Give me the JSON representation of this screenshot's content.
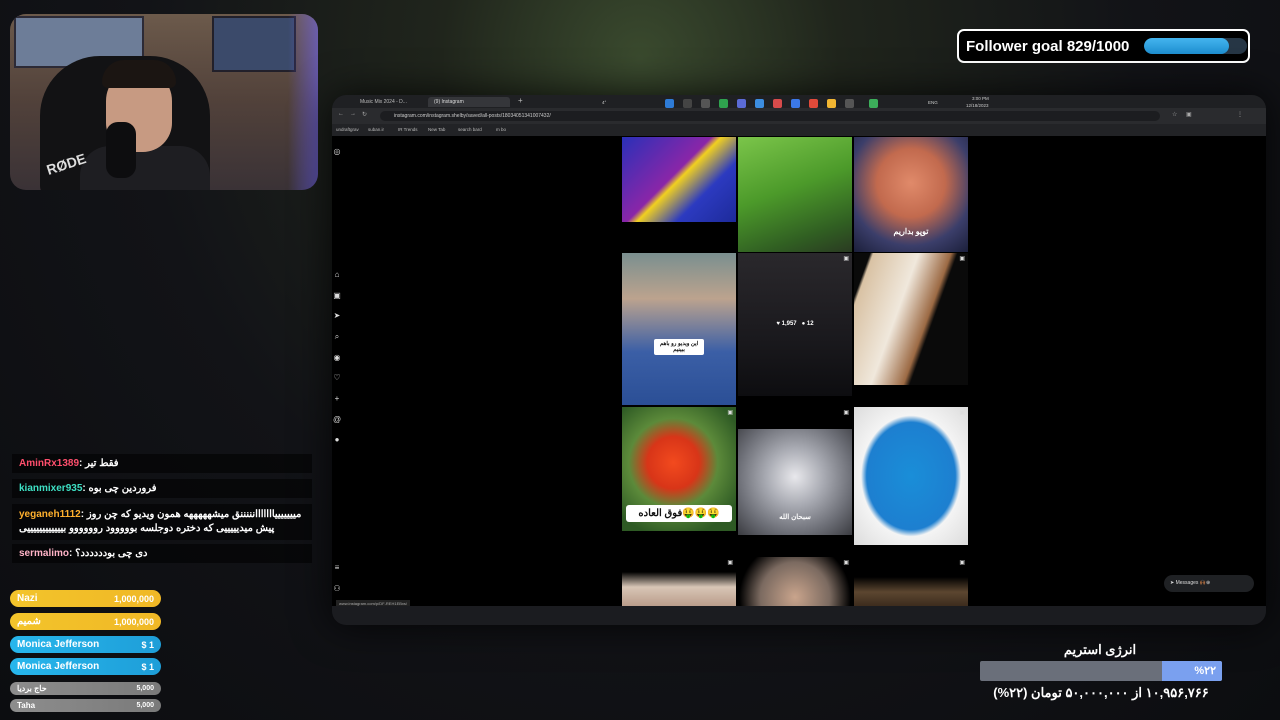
{
  "follower_goal": {
    "text": "Follower goal 829/1000",
    "current": 829,
    "target": 1000
  },
  "browser": {
    "tabs": [
      "Music Mix 2024 - D...",
      "(9) Instagram"
    ],
    "url": "instagram.com/instagram.shelby/saved/all-posts/18034051341007432/",
    "bookmarks": [
      "undraftgrav",
      "suban.ir",
      "IR Trends",
      "New Tab",
      "search bard",
      "m bo"
    ],
    "messages_label": "Messages",
    "status_url": "www.instagram.com/p/DF-REH1EBxs/"
  },
  "feed": {
    "captions": {
      "c3": "توپو بداریم",
      "c4": "این ویدیو رو باهم ببینیم",
      "c7": "فوق العاده🤑🤑🤑",
      "c8": "سبحان الله"
    },
    "post5_stats": {
      "likes": "1,957",
      "comments": "12"
    }
  },
  "taskbar": {
    "weather": "4°",
    "lang": "ENG",
    "time": "3:00 PM",
    "date": "12/18/2023"
  },
  "chat": [
    {
      "user": "AminRx1389",
      "message": "فقط تیر",
      "color": "#ff4f6d"
    },
    {
      "user": "kianmixer935",
      "message": "فروردین چی بوه",
      "color": "#3ee0c4"
    },
    {
      "user": "yeganeh1112",
      "message": "میییییییااااااانننننق میشهههههه همون ویدیو که چن روز پیش میدیییییی که دختره دوجلسه بووووود روووووو بییییییییییییی",
      "color": "#ffb02e"
    },
    {
      "user": "sermalimo",
      "message": "دی چی بودددددد؟",
      "color": "#ffb3c7"
    }
  ],
  "donations": [
    {
      "name": "Nazi",
      "amount": "1,000,000",
      "style": "yellow"
    },
    {
      "name": "شمیم",
      "amount": "1,000,000",
      "style": "yellow"
    },
    {
      "name": "Monica Jefferson",
      "amount": "$ 1",
      "style": "blue"
    },
    {
      "name": "Monica Jefferson",
      "amount": "$ 1",
      "style": "blue"
    },
    {
      "name": "حاج بردیا",
      "amount": "5,000",
      "style": "gray"
    },
    {
      "name": "Taha",
      "amount": "5,000",
      "style": "gray"
    }
  ],
  "stream_energy": {
    "title": "انرژی استریم",
    "percent_label": "%۲۲",
    "progress": 0.22,
    "caption": "۱۰,۹۵۶,۷۶۶ از ۵۰,۰۰۰,۰۰۰ تومان (۲۲%)"
  }
}
